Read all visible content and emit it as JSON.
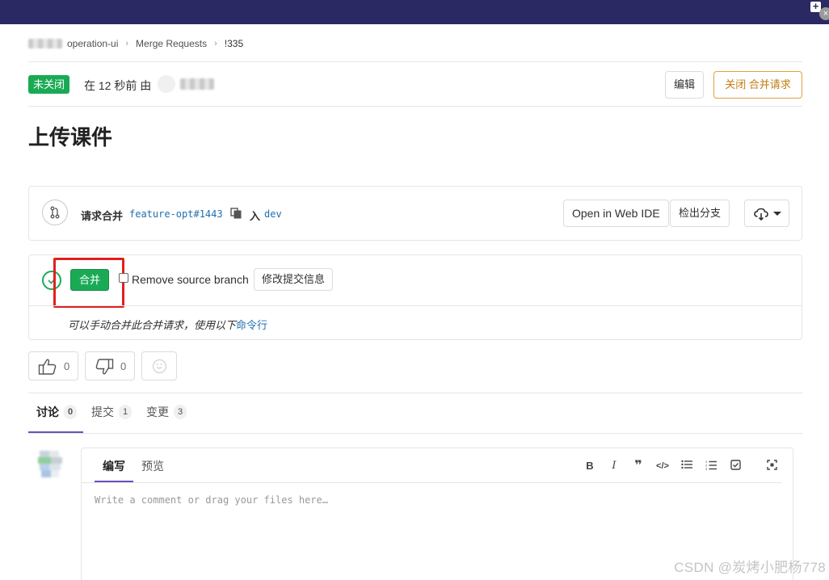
{
  "breadcrumb": {
    "project": "operation-ui",
    "section": "Merge Requests",
    "current": "!335"
  },
  "status": {
    "badge": "未关闭",
    "opened_text": "在 12 秒前 由"
  },
  "header_buttons": {
    "edit": "编辑",
    "close": "关闭 合并请求"
  },
  "title": "上传课件",
  "branch_info": {
    "request_label": "请求合并",
    "source_branch": "feature-opt#1443",
    "into_label": "入",
    "target_branch": "dev",
    "open_web_ide": "Open in Web IDE",
    "checkout_branch": "检出分支"
  },
  "merge_widget": {
    "merge_button": "合并",
    "remove_source_branch": "Remove source branch",
    "edit_commit_message": "修改提交信息",
    "manual_text": "可以手动合并此合并请求，使用以下",
    "command_line_link": "命令行"
  },
  "awards": {
    "thumbs_up": "0",
    "thumbs_down": "0"
  },
  "tabs": [
    {
      "label": "讨论",
      "count": "0"
    },
    {
      "label": "提交",
      "count": "1"
    },
    {
      "label": "变更",
      "count": "3"
    }
  ],
  "editor": {
    "write_tab": "编写",
    "preview_tab": "预览",
    "placeholder": "Write a comment or drag your files here…",
    "tools": [
      "bold-icon",
      "italic-icon",
      "quote-icon",
      "code-icon",
      "bullet-list-icon",
      "numbered-list-icon",
      "task-list-icon",
      "fullscreen-icon"
    ]
  },
  "watermark": "CSDN @炭烤小肥杨778",
  "colors": {
    "topbar": "#2b2963",
    "success": "#1aaa55",
    "warning": "#e0a240",
    "link": "#1f6fb0",
    "active_tab": "#6b4fbb",
    "highlight": "#e02020"
  }
}
